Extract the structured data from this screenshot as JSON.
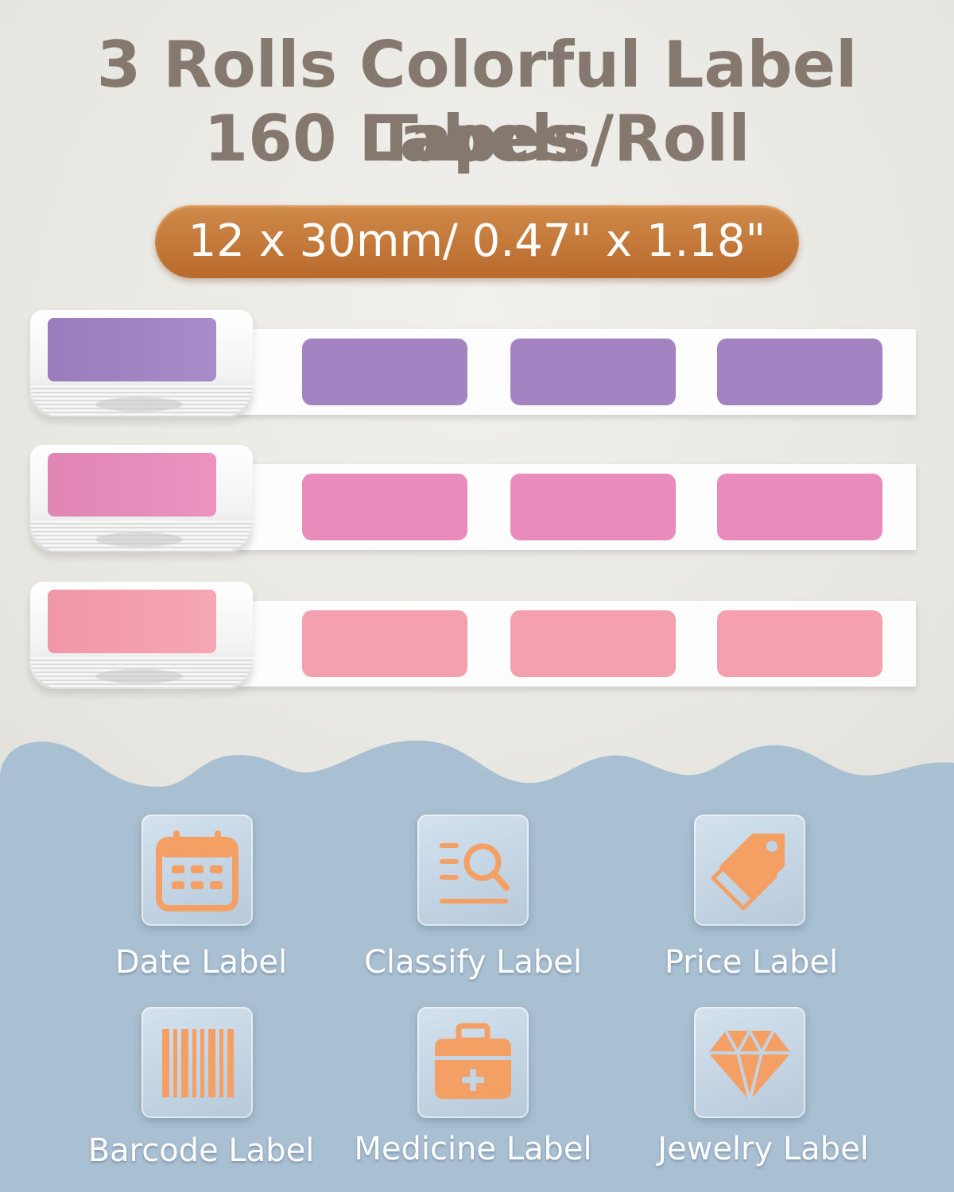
{
  "header": {
    "title_line1": "3 Rolls Colorful Label Tapes",
    "title_line2": "160 Labels/Roll",
    "size": "12 x 30mm/ 0.47\" x 1.18\""
  },
  "rolls": [
    {
      "name": "purple",
      "color": "#a383c2"
    },
    {
      "name": "pink",
      "color": "#ea8cbb"
    },
    {
      "name": "light-pink",
      "color": "#f5a0ae"
    }
  ],
  "uses": [
    {
      "label": "Date Label",
      "icon": "calendar-icon"
    },
    {
      "label": "Classify Label",
      "icon": "classify-search-icon"
    },
    {
      "label": "Price Label",
      "icon": "price-tag-icon"
    },
    {
      "label": "Barcode Label",
      "icon": "barcode-icon"
    },
    {
      "label": "Medicine Label",
      "icon": "medicine-box-icon"
    },
    {
      "label": "Jewelry Label",
      "icon": "diamond-icon"
    }
  ],
  "colors": {
    "title": "#85786e",
    "pill": "#c27636",
    "blue_bg": "#a8bfd3",
    "icon_orange": "#f4a064"
  }
}
